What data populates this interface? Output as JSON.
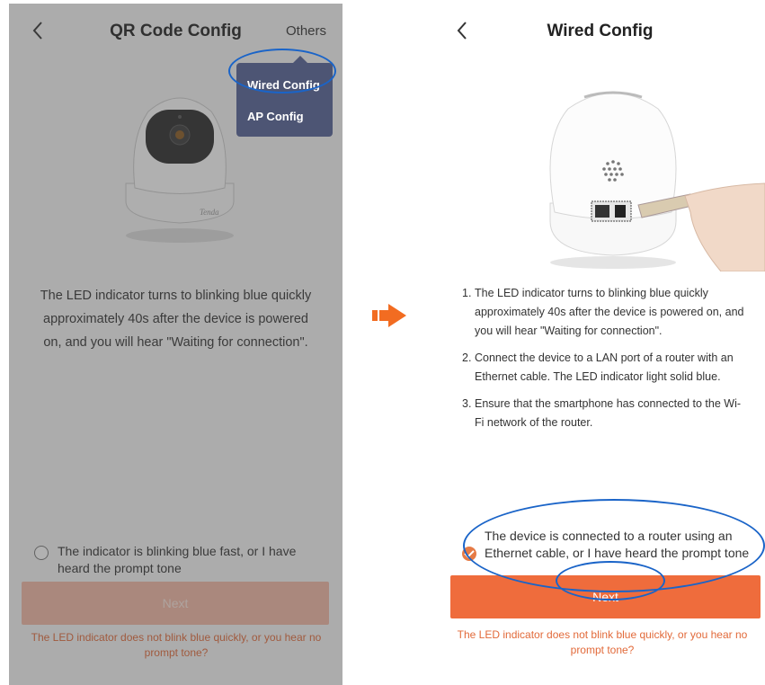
{
  "left_screen": {
    "title": "QR Code Config",
    "others_label": "Others",
    "menu": [
      "Wired Config",
      "AP Config"
    ],
    "camera_brand": "Tenda",
    "instruction": "The LED indicator turns to blinking blue quickly approximately 40s after the device is powered on, and you will hear \"Waiting for connection\".",
    "checkbox_label": "The indicator is blinking blue fast, or I have heard the prompt tone",
    "checkbox_checked": false,
    "next_label": "Next",
    "help_text": "The LED indicator does not blink blue quickly, or you hear no prompt tone?"
  },
  "right_screen": {
    "title": "Wired Config",
    "steps": [
      {
        "num": "1.",
        "text": "The LED indicator turns to blinking blue quickly approximately 40s after the device is powered on, and you will hear \"Waiting for connection\"."
      },
      {
        "num": "2.",
        "text": "Connect the device to a LAN port of a router with an Ethernet cable. The LED indicator light solid blue."
      },
      {
        "num": "3.",
        "text": "Ensure that the smartphone has connected to the Wi-Fi network of the router."
      }
    ],
    "checkbox_label": "The device is connected to a router using an Ethernet cable, or I have heard the prompt tone",
    "checkbox_checked": true,
    "next_label": "Next",
    "help_text": "The LED indicator does not blink blue quickly, or you hear no prompt tone?"
  },
  "colors": {
    "accent": "#ef6c3c",
    "accent_dimmed": "#f3b9a5",
    "annotation": "#1a64c8",
    "menu_bg": "#4d5574",
    "help_text": "#e26a3a"
  },
  "icons": [
    "back-chevron-icon",
    "arrow-right-icon",
    "checkmark-icon"
  ]
}
